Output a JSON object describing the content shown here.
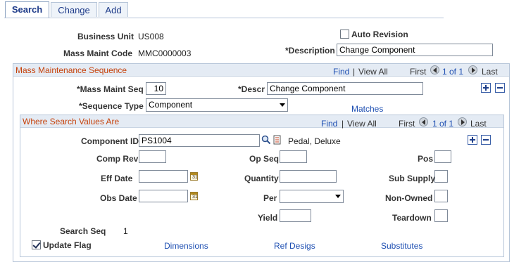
{
  "tabs": [
    {
      "label": "Search",
      "active": true
    },
    {
      "label": "Change",
      "active": false
    },
    {
      "label": "Add",
      "active": false
    }
  ],
  "header": {
    "business_unit_label": "Business Unit",
    "business_unit_value": "US008",
    "mass_maint_code_label": "Mass Maint Code",
    "mass_maint_code_value": "MMC0000003",
    "auto_revision_label": "Auto Revision",
    "auto_revision_checked": false,
    "description_label": "*Description",
    "description_value": "Change Component"
  },
  "sequence": {
    "title": "Mass Maintenance Sequence",
    "nav": {
      "find": "Find",
      "sep": "|",
      "view_all": "View All",
      "first": "First",
      "count": "1 of 1",
      "last": "Last"
    },
    "seq_label": "*Mass Maint Seq",
    "seq_value": "10",
    "descr_label": "*Descr",
    "descr_value": "Change Component",
    "sequence_type_label": "*Sequence Type",
    "sequence_type_value": "Component",
    "matches_link": "Matches"
  },
  "where": {
    "title": "Where Search Values Are",
    "nav": {
      "find": "Find",
      "sep": "|",
      "view_all": "View All",
      "first": "First",
      "count": "1 of 1",
      "last": "Last"
    },
    "component_id_label": "Component ID",
    "component_id_value": "PS1004",
    "component_desc": "Pedal, Deluxe",
    "comp_rev_label": "Comp Rev",
    "comp_rev_value": "",
    "op_seq_label": "Op Seq",
    "op_seq_value": "",
    "pos_label": "Pos",
    "pos_value": "",
    "eff_date_label": "Eff Date",
    "eff_date_value": "",
    "quantity_label": "Quantity",
    "quantity_value": "",
    "sub_supply_label": "Sub Supply",
    "obs_date_label": "Obs Date",
    "obs_date_value": "",
    "per_label": "Per",
    "per_value": "",
    "non_owned_label": "Non-Owned",
    "yield_label": "Yield",
    "yield_value": "",
    "teardown_label": "Teardown",
    "search_seq_label": "Search Seq",
    "search_seq_value": "1",
    "update_flag_label": "Update Flag",
    "update_flag_checked": true,
    "links": {
      "dimensions": "Dimensions",
      "ref_desigs": "Ref Desigs",
      "substitutes": "Substitutes"
    }
  },
  "icons": {
    "calendar_day": "31"
  },
  "colors": {
    "section_title": "#c6410a",
    "link": "#1e4fb2",
    "header_band": "#e4ebf4"
  }
}
